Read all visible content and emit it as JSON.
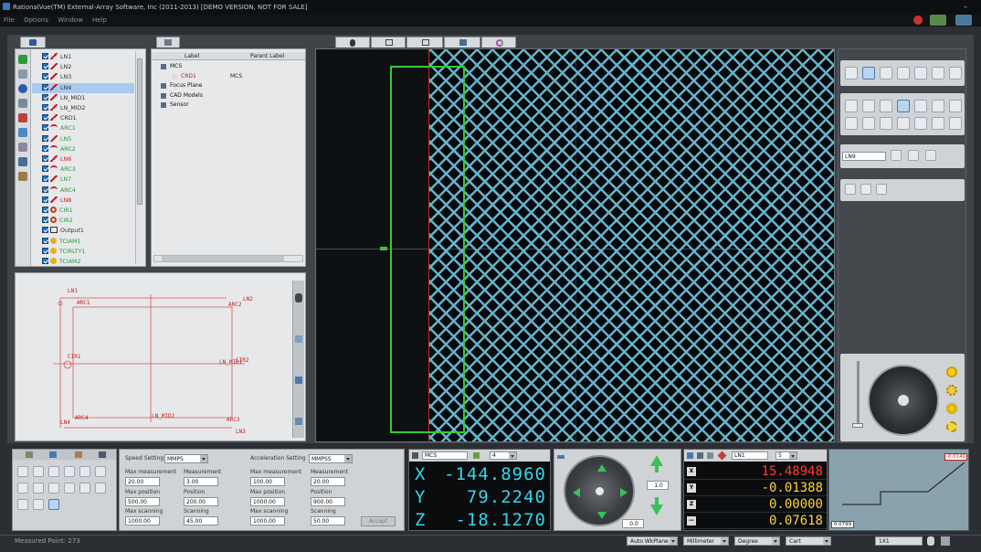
{
  "window": {
    "title": "RationalVue(TM) External-Array Software, Inc (2011-2013) [DEMO VERSION, NOT FOR SALE]"
  },
  "menu": [
    "File",
    "Options",
    "Window",
    "Help"
  ],
  "feature_tree": {
    "items": [
      {
        "label": "LN1",
        "color": "black",
        "icon": "line-icon"
      },
      {
        "label": "LN2",
        "color": "black",
        "icon": "line-icon"
      },
      {
        "label": "LN3",
        "color": "black",
        "icon": "line-icon"
      },
      {
        "label": "LN4",
        "color": "black",
        "icon": "line-icon",
        "selected": true
      },
      {
        "label": "LN_MID1",
        "color": "black",
        "icon": "line-icon"
      },
      {
        "label": "LN_MID2",
        "color": "black",
        "icon": "line-icon"
      },
      {
        "label": "CRD1",
        "color": "black",
        "icon": "coordinate-icon"
      },
      {
        "label": "ARC1",
        "color": "green",
        "icon": "arc-icon"
      },
      {
        "label": "LN5",
        "color": "green",
        "icon": "line-icon"
      },
      {
        "label": "ARC2",
        "color": "green",
        "icon": "arc-icon"
      },
      {
        "label": "LN6",
        "color": "red",
        "icon": "line-icon"
      },
      {
        "label": "ARC3",
        "color": "green",
        "icon": "arc-icon"
      },
      {
        "label": "LN7",
        "color": "green",
        "icon": "line-icon"
      },
      {
        "label": "ARC4",
        "color": "green",
        "icon": "arc-icon"
      },
      {
        "label": "LN8",
        "color": "red",
        "icon": "line-icon"
      },
      {
        "label": "CIR1",
        "color": "green",
        "icon": "circle-icon"
      },
      {
        "label": "CIR2",
        "color": "green",
        "icon": "circle-icon"
      },
      {
        "label": "Output1",
        "color": "black",
        "icon": "output-icon"
      },
      {
        "label": "TCIAM1",
        "color": "green",
        "icon": "tolerance-icon"
      },
      {
        "label": "TCIRLTY1",
        "color": "green",
        "icon": "tolerance-icon"
      },
      {
        "label": "TCIAM2",
        "color": "green",
        "icon": "tolerance-icon"
      }
    ]
  },
  "coord_table": {
    "headers": {
      "label": "Label",
      "parent": "Parent Label"
    },
    "rows": [
      {
        "label": "MCS",
        "parent": "",
        "color": "black"
      },
      {
        "label": "CRD1",
        "parent": "MCS",
        "color": "red"
      },
      {
        "label": "Focus Plane",
        "parent": "",
        "color": "black"
      },
      {
        "label": "CAD Models",
        "parent": "",
        "color": "black"
      },
      {
        "label": "Sensor",
        "parent": "",
        "color": "black"
      }
    ]
  },
  "drawing": {
    "labels": [
      "LN1",
      "ARC1",
      "LN2",
      "ARC2",
      "CIR1",
      "LN_MID1",
      "CIR2",
      "ARC4",
      "LN_MID2",
      "ARC3",
      "LN4",
      "LN3"
    ]
  },
  "feature_name_input": "LN9",
  "speed": {
    "title": "Speed Setting",
    "unit": "MMPS",
    "max_measurement_label": "Max measurement",
    "max_measurement": "20.00",
    "measurement_label": "Measurement",
    "measurement": "3.00",
    "max_position_label": "Max position",
    "max_position": "500.00",
    "position_label": "Position",
    "position": "200.00",
    "max_scanning_label": "Max scanning",
    "max_scanning": "1000.00",
    "scanning_label": "Scanning",
    "scanning": "45.00"
  },
  "acceleration": {
    "title": "Acceleration Setting",
    "unit": "MMPSS",
    "max_measurement_label": "Max measurement",
    "max_measurement": "100.00",
    "measurement_label": "Measurement",
    "measurement": "20.00",
    "max_position_label": "Max position",
    "max_position": "1000.00",
    "position_label": "Position",
    "position": "900.00",
    "max_scanning_label": "Max scanning",
    "max_scanning": "1000.00",
    "scanning_label": "Scanning",
    "scanning": "50.00",
    "accept_label": "Accept"
  },
  "dro": {
    "frame": "MCS",
    "precision": "4",
    "x_axis": "X",
    "x": "-144.8960",
    "y_axis": "Y",
    "y": "79.2240",
    "z_axis": "Z",
    "z": "-18.1270"
  },
  "jog": {
    "speed": "1.0",
    "z_speed": "0.0"
  },
  "feature_values": {
    "name": "LN1",
    "count": "5",
    "rows": [
      {
        "key": "X",
        "value": "15.48948",
        "color": "#ff3a3a"
      },
      {
        "key": "Y",
        "value": "-0.01388",
        "color": "#ffd23a"
      },
      {
        "key": "Z",
        "value": "0.00000",
        "color": "#ffd23a"
      },
      {
        "key": "—",
        "value": "0.07618",
        "color": "#ffd23a"
      }
    ]
  },
  "profile": {
    "tol_top": "-0.0140",
    "tol_bottom": "0.0799"
  },
  "status": {
    "text": "Measured Point: 273",
    "workplane": "Auto WkPlane",
    "units": "Millimeter",
    "angle": "Degree",
    "coords": "Cart",
    "zoom": "1X1"
  },
  "colors": {
    "dro_digits": "#35d4ea",
    "roi_box": "#37c837",
    "tree_selected": "#a9c9ef"
  }
}
